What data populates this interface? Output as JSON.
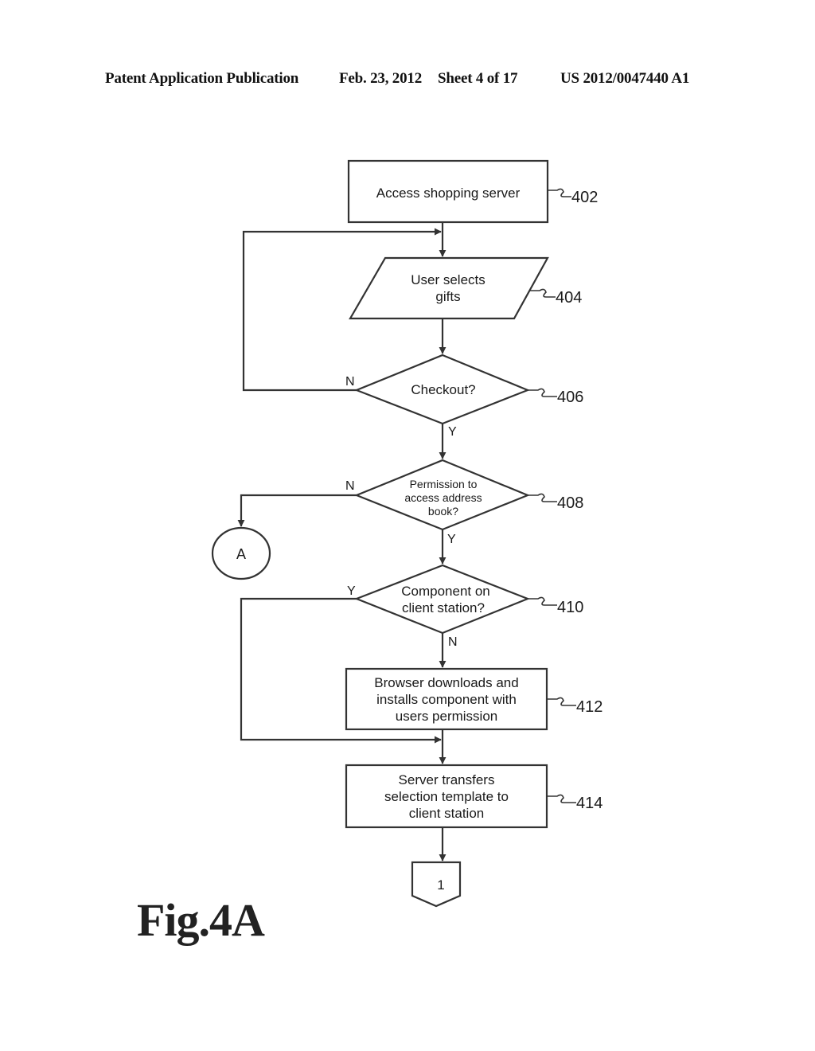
{
  "header": {
    "publication": "Patent Application Publication",
    "date": "Feb. 23, 2012",
    "sheet": "Sheet 4 of 17",
    "number": "US 2012/0047440 A1"
  },
  "figure_label": "Fig.4A",
  "flowchart": {
    "nodes": {
      "n402": {
        "shape": "process",
        "lines": [
          "Access shopping server"
        ],
        "ref": "402"
      },
      "n404": {
        "shape": "input-output",
        "lines": [
          "User selects",
          "gifts"
        ],
        "ref": "404"
      },
      "n406": {
        "shape": "decision",
        "lines": [
          "Checkout?"
        ],
        "ref": "406"
      },
      "n408": {
        "shape": "decision",
        "lines": [
          "Permission to",
          "access address",
          "book?"
        ],
        "ref": "408"
      },
      "n410": {
        "shape": "decision",
        "lines": [
          "Component on",
          "client station?"
        ],
        "ref": "410"
      },
      "n412": {
        "shape": "process",
        "lines": [
          "Browser downloads and",
          "installs component with",
          "users permission"
        ],
        "ref": "412"
      },
      "n414": {
        "shape": "process",
        "lines": [
          "Server transfers",
          "selection template to",
          "client station"
        ],
        "ref": "414"
      },
      "connA": {
        "shape": "connector",
        "lines": [
          "A"
        ]
      },
      "page1": {
        "shape": "off-page-connector",
        "lines": [
          "1"
        ]
      }
    },
    "edges": [
      {
        "from": "402",
        "to": "404",
        "label": ""
      },
      {
        "from": "404",
        "to": "406",
        "label": ""
      },
      {
        "from": "406",
        "to": "404",
        "label": "N"
      },
      {
        "from": "406",
        "to": "408",
        "label": "Y"
      },
      {
        "from": "408",
        "to": "A",
        "label": "N"
      },
      {
        "from": "408",
        "to": "410",
        "label": "Y"
      },
      {
        "from": "410",
        "to": "414",
        "label": "Y"
      },
      {
        "from": "410",
        "to": "412",
        "label": "N"
      },
      {
        "from": "412",
        "to": "414",
        "label": ""
      },
      {
        "from": "414",
        "to": "1",
        "label": ""
      }
    ],
    "branch_labels": {
      "b406_n": "N",
      "b406_y": "Y",
      "b408_n": "N",
      "b408_y": "Y",
      "b410_y": "Y",
      "b410_n": "N"
    }
  }
}
